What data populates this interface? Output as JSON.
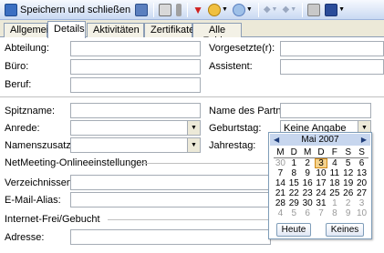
{
  "toolbar": {
    "save_close_label": "Speichern und schließen",
    "save_close_accel": "S",
    "icons": [
      "save-close-icon",
      "save-icon",
      "print-icon",
      "attach-icon",
      "flag-icon",
      "categorize-icon",
      "recurrence-icon",
      "previous-item-icon",
      "next-item-icon",
      "address-book-icon",
      "help-icon"
    ]
  },
  "tabs": [
    {
      "label": "Allgemein"
    },
    {
      "label": "Details"
    },
    {
      "label": "Aktivitäten"
    },
    {
      "label": "Zertifikate"
    },
    {
      "label": "Alle Felder"
    }
  ],
  "form": {
    "abteilung": "Abteilung:",
    "buero": "Büro:",
    "beruf": "Beruf:",
    "vorgesetzte": "Vorgesetzte(r):",
    "assistent": "Assistent:",
    "spitzname": "Spitzname:",
    "anrede": "Anrede:",
    "namenszusatz": "Namenszusatz:",
    "partner": "Name des Partners:",
    "geburtstag": "Geburtstag:",
    "geburtstag_value": "Keine Angabe",
    "jahrestag": "Jahrestag:",
    "netmeeting_section": "NetMeeting-Onlineeinstellungen",
    "verzeichnisserver": "Verzeichnisserver:",
    "email_alias": "E-Mail-Alias:",
    "freebusy_section": "Internet-Frei/Gebucht",
    "adresse": "Adresse:"
  },
  "calendar": {
    "month_label": "Mai 2007",
    "weekdays": [
      "M",
      "D",
      "M",
      "D",
      "F",
      "S",
      "S"
    ],
    "weeks": [
      [
        "30",
        "1",
        "2",
        "3",
        "4",
        "5",
        "6"
      ],
      [
        "7",
        "8",
        "9",
        "10",
        "11",
        "12",
        "13"
      ],
      [
        "14",
        "15",
        "16",
        "17",
        "18",
        "19",
        "20"
      ],
      [
        "21",
        "22",
        "23",
        "24",
        "25",
        "26",
        "27"
      ],
      [
        "28",
        "29",
        "30",
        "31",
        "1",
        "2",
        "3"
      ],
      [
        "4",
        "5",
        "6",
        "7",
        "8",
        "9",
        "10"
      ]
    ],
    "today_button": "Heute",
    "none_button": "Keines"
  }
}
